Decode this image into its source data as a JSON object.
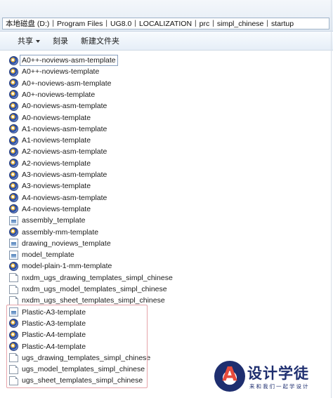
{
  "breadcrumbs": [
    "本地磁盘 (D:)",
    "Program Files",
    "UG8.0",
    "LOCALIZATION",
    "prc",
    "simpl_chinese",
    "startup"
  ],
  "toolbar": {
    "share_label": "共享",
    "burn_label": "刻录",
    "new_folder_label": "新建文件夹"
  },
  "files": [
    {
      "name": "A0++-noviews-asm-template",
      "icon": "ug-part-icon"
    },
    {
      "name": "A0++-noviews-template",
      "icon": "ug-part-icon"
    },
    {
      "name": "A0+-noviews-asm-template",
      "icon": "ug-part-icon"
    },
    {
      "name": "A0+-noviews-template",
      "icon": "ug-part-icon"
    },
    {
      "name": "A0-noviews-asm-template",
      "icon": "ug-part-icon"
    },
    {
      "name": "A0-noviews-template",
      "icon": "ug-part-icon"
    },
    {
      "name": "A1-noviews-asm-template",
      "icon": "ug-part-icon"
    },
    {
      "name": "A1-noviews-template",
      "icon": "ug-part-icon"
    },
    {
      "name": "A2-noviews-asm-template",
      "icon": "ug-part-icon"
    },
    {
      "name": "A2-noviews-template",
      "icon": "ug-part-icon"
    },
    {
      "name": "A3-noviews-asm-template",
      "icon": "ug-part-icon"
    },
    {
      "name": "A3-noviews-template",
      "icon": "ug-part-icon"
    },
    {
      "name": "A4-noviews-asm-template",
      "icon": "ug-part-icon"
    },
    {
      "name": "A4-noviews-template",
      "icon": "ug-part-icon"
    },
    {
      "name": "assembly_template",
      "icon": "image-file-icon"
    },
    {
      "name": "assembly-mm-template",
      "icon": "ug-part-icon"
    },
    {
      "name": "drawing_noviews_template",
      "icon": "image-file-icon"
    },
    {
      "name": "model_template",
      "icon": "image-file-icon"
    },
    {
      "name": "model-plain-1-mm-template",
      "icon": "ug-part-icon"
    },
    {
      "name": "nxdm_ugs_drawing_templates_simpl_chinese",
      "icon": "text-file-icon"
    },
    {
      "name": "nxdm_ugs_model_templates_simpl_chinese",
      "icon": "text-file-icon"
    },
    {
      "name": "nxdm_ugs_sheet_templates_simpl_chinese",
      "icon": "text-file-icon"
    },
    {
      "name": "Plastic-A3-template",
      "icon": "image-file-icon"
    },
    {
      "name": "Plastic-A3-template",
      "icon": "ug-part-icon"
    },
    {
      "name": "Plastic-A4-template",
      "icon": "ug-part-icon"
    },
    {
      "name": "Plastic-A4-template",
      "icon": "ug-part-icon"
    },
    {
      "name": "ugs_drawing_templates_simpl_chinese",
      "icon": "text-file-icon"
    },
    {
      "name": "ugs_model_templates_simpl_chinese",
      "icon": "text-file-icon"
    },
    {
      "name": "ugs_sheet_templates_simpl_chinese",
      "icon": "text-file-icon"
    }
  ],
  "selected_index": 0,
  "watermark": {
    "logo_letter": "A",
    "title": "设计学徒",
    "subtitle": "来和我们一起学设计"
  },
  "colors": {
    "highlight_box": "#e6a3a9",
    "watermark_blue": "#1e2e6f",
    "watermark_red": "#e84b3c"
  }
}
